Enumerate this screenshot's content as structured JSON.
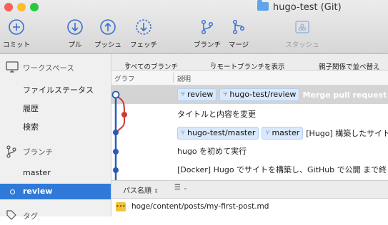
{
  "window": {
    "title": "hugo-test (Git)",
    "traffic_colors": [
      "#fc5f57",
      "#fdbc2e",
      "#28c840"
    ]
  },
  "toolbar": {
    "commit": "コミット",
    "pull": "プル",
    "push": "プッシュ",
    "fetch": "フェッチ",
    "branch": "ブランチ",
    "merge": "マージ",
    "stash": "スタッシュ"
  },
  "sidebar": {
    "workspace_header": "ワークスペース",
    "workspace_items": [
      "ファイルステータス",
      "履歴",
      "検索"
    ],
    "branches_header": "ブランチ",
    "branches": [
      "master",
      "review"
    ],
    "tags_header": "タグ"
  },
  "filter": {
    "all_branches": "すべてのブランチ",
    "show_remote": "リモートブランチを表示",
    "sort": "親子関係で並べ替え"
  },
  "columns": {
    "graph": "グラフ",
    "description": "説明"
  },
  "commits": [
    {
      "tags": [
        "review",
        "hugo-test/review"
      ],
      "message": "Merge pull request #"
    },
    {
      "tags": [],
      "message": "タイトルと内容を変更"
    },
    {
      "tags": [
        "hugo-test/master",
        "master"
      ],
      "message": "[Hugo] 構築したサイト"
    },
    {
      "tags": [],
      "message": "hugo を初めて実行"
    },
    {
      "tags": [],
      "message": "[Docker] Hugo でサイトを構築し、GitHub で公開 まで終"
    }
  ],
  "bottom": {
    "sort_path": "パス名順",
    "list_icon": "list-icon",
    "file_path": "hoge/content/posts/my-first-post.md",
    "file_status_icon": "modified-file-icon"
  },
  "colors": {
    "accent": "#2f7ad8",
    "graph_blue": "#2a5ab8",
    "graph_red": "#d03a32"
  }
}
